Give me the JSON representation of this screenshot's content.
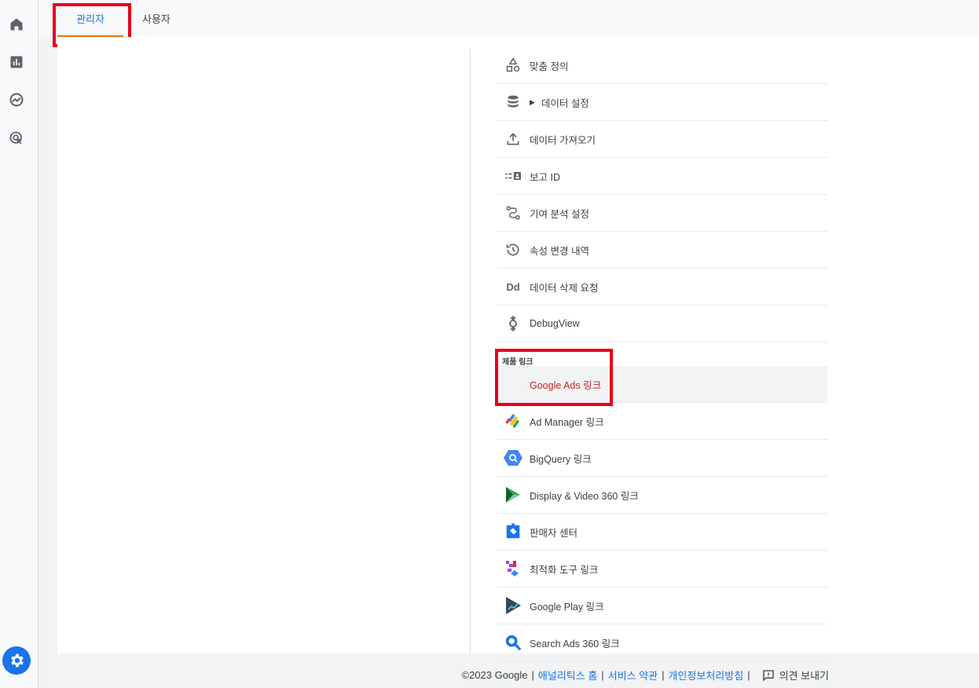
{
  "tabs": {
    "admin": "관리자",
    "user": "사용자"
  },
  "sidebar_icons": [
    "home-icon",
    "reports-icon",
    "explore-icon",
    "advertising-icon",
    "settings-gear-icon"
  ],
  "menu": {
    "items": [
      {
        "label": "맞춤 정의",
        "icon": "custom-definitions-icon"
      },
      {
        "label": "데이터 설정",
        "icon": "database-icon",
        "expandable": true
      },
      {
        "label": "데이터 가져오기",
        "icon": "upload-icon"
      },
      {
        "label": "보고 ID",
        "icon": "reporting-identity-icon"
      },
      {
        "label": "기여 분석 설정",
        "icon": "attribution-icon"
      },
      {
        "label": "속성 변경 내역",
        "icon": "history-icon"
      },
      {
        "label": "데이터 삭제 요청",
        "icon": "data-deletion-icon"
      },
      {
        "label": "DebugView",
        "icon": "debugview-icon"
      }
    ],
    "section_title": "제품 링크",
    "links": [
      {
        "label": "Google Ads 링크",
        "icon": "google-ads-icon",
        "active": true
      },
      {
        "label": "Ad Manager 링크",
        "icon": "ad-manager-icon"
      },
      {
        "label": "BigQuery 링크",
        "icon": "bigquery-icon"
      },
      {
        "label": "Display & Video 360 링크",
        "icon": "display-video-360-icon"
      },
      {
        "label": "판매자 센터",
        "icon": "merchant-center-icon"
      },
      {
        "label": "최적화 도구 링크",
        "icon": "optimize-icon"
      },
      {
        "label": "Google Play 링크",
        "icon": "google-play-icon"
      },
      {
        "label": "Search Ads 360 링크",
        "icon": "search-ads-360-icon"
      }
    ]
  },
  "footer": {
    "copyright": "©2023 Google",
    "sep": "|",
    "links": [
      "애널리틱스 홈",
      "서비스 약관",
      "개인정보처리방침"
    ],
    "feedback": "의견 보내기"
  },
  "colors": {
    "accent": "#1a73e8",
    "active_text": "#c5221f",
    "highlight_box": "#e8001c",
    "tab_underline": "#e8710a"
  }
}
